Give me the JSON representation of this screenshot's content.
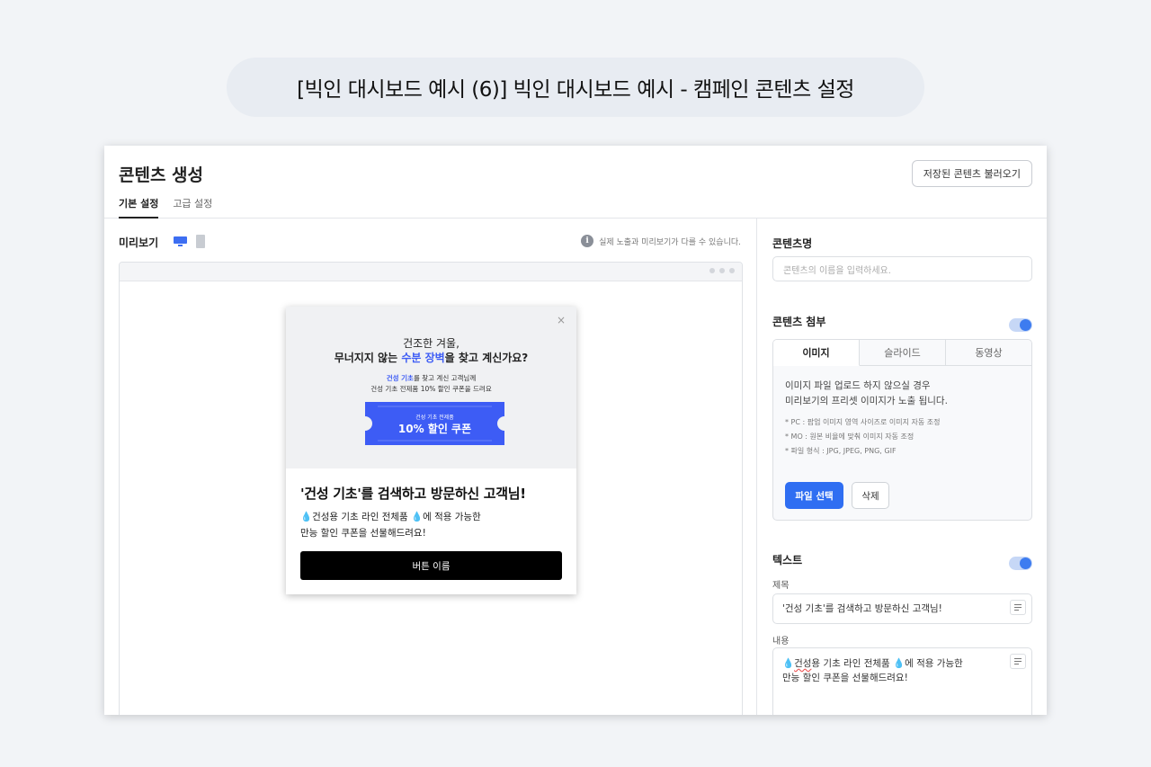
{
  "page_title": "[빅인 대시보드 예시 (6)] 빅인 대시보드 예시 - 캠페인 콘텐츠 설정",
  "header": {
    "title": "콘텐츠 생성",
    "load_button": "저장된 콘텐츠 불러오기",
    "tabs": [
      {
        "label": "기본 설정",
        "active": true
      },
      {
        "label": "고급 설정",
        "active": false
      }
    ]
  },
  "preview": {
    "label": "미리보기",
    "device_icons": [
      "desktop-icon",
      "mobile-icon"
    ],
    "notice": "실제 노출과 미리보기가 다를 수 있습니다.",
    "popup": {
      "close": "×",
      "promo_line1": "건조한 겨울,",
      "promo_line2_a": "무너지지 않는 ",
      "promo_line2_hl": "수분 장벽",
      "promo_line2_b": "을 찾고 계신가요?",
      "promo_sub1_hl": "건성 기초",
      "promo_sub1_b": "를 찾고 계신 고객님께",
      "promo_sub2": "건성 기초 전제품 10% 할인 쿠폰을 드려요",
      "coupon_small": "건성 기초 전제품",
      "coupon_big": "10% 할인 쿠폰",
      "title": "'건성 기초'를 검색하고 방문하신 고객님!",
      "body_line1_a": "건성용 기초 라인 전체품 ",
      "body_line1_b": "에 적용 가능한",
      "body_line2": "만능 할인 쿠폰을 선물해드려요!",
      "drop_glyph": "💧",
      "button": "버튼 이름"
    }
  },
  "settings": {
    "content_name": {
      "label": "콘텐츠명",
      "placeholder": "콘텐츠의 이름을 입력하세요."
    },
    "attachment": {
      "label": "콘텐츠 첨부",
      "enabled": true,
      "tabs": [
        {
          "label": "이미지",
          "active": true
        },
        {
          "label": "슬라이드",
          "active": false
        },
        {
          "label": "동영상",
          "active": false
        }
      ],
      "desc_line1": "이미지 파일 업로드 하지 않으실 경우",
      "desc_line2": "미리보기의 프리셋 이미지가 노출 됩니다.",
      "notes": [
        "* PC : 팝업 이미지 영역 사이즈로 이미지 자동 조정",
        "* MO : 원본 비율에 맞춰 이미지 자동 조정",
        "* 파일 형식 : JPG, JPEG, PNG, GIF"
      ],
      "file_button": "파일 선택",
      "delete_button": "삭제"
    },
    "text": {
      "label": "텍스트",
      "enabled": true,
      "title_label": "제목",
      "title_value": "'건성 기초'를 검색하고 방문하신 고객님!",
      "body_label": "내용",
      "body_line1_a": "건성",
      "body_line1_b": "용 기초 라인 전체품 ",
      "body_line1_c": "에 적용 가능한",
      "body_line2": "만능 할인 쿠폰을 선물해드려요!"
    }
  },
  "colors": {
    "accent": "#2f6ef2",
    "highlight": "#3d5cf5",
    "coupon": "#3d5cf5",
    "toggle": "#3d7cf0"
  }
}
